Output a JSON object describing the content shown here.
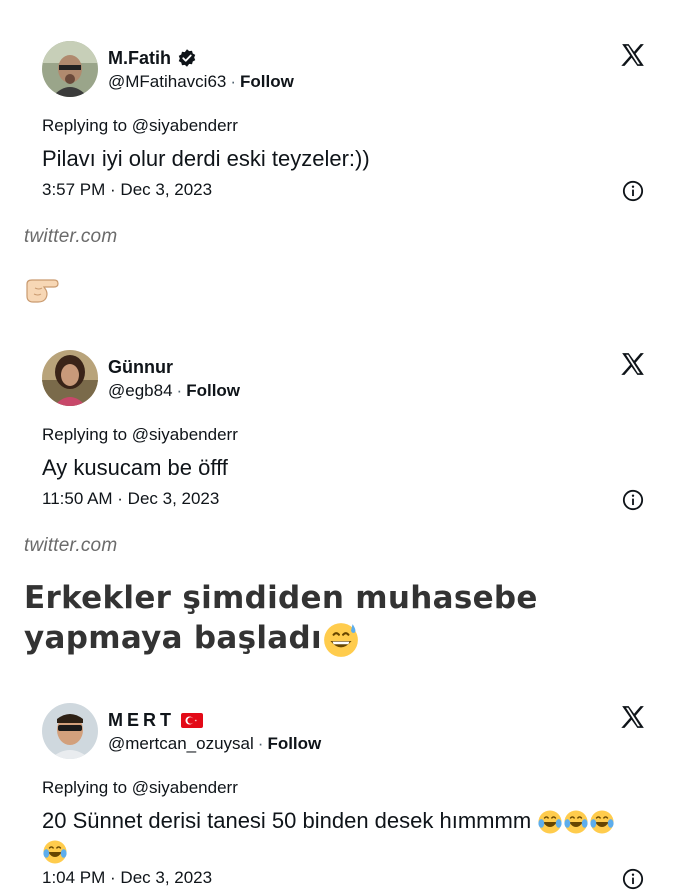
{
  "tweets": [
    {
      "name": "M.Fatih",
      "verified": true,
      "handle": "@MFatihavci63",
      "separator": "·",
      "follow": "Follow",
      "replying": "Replying to @siyabenderr",
      "text": "Pilavı iyi olur derdi eski teyzeler:))",
      "meta": "3:57 PM · Dec 3, 2023"
    },
    {
      "name": "Günnur",
      "verified": false,
      "handle": "@egb84",
      "separator": "·",
      "follow": "Follow",
      "replying": "Replying to @siyabenderr",
      "text": "Ay kusucam be öfff",
      "meta": "11:50 AM · Dec 3, 2023"
    },
    {
      "name": "MERT",
      "flag": "turkey-flag",
      "verified": false,
      "handle": "@mertcan_ozuysal",
      "separator": "·",
      "follow": "Follow",
      "replying": "Replying to @siyabenderr",
      "text": "20 Sünnet derisi tanesi 50 binden desek hımmmm",
      "text_emoji": "face-with-tears-of-joy",
      "meta": "1:04 PM · Dec 3, 2023"
    }
  ],
  "source": "twitter.com",
  "hand_icon": "backhand-index-pointing-right",
  "headline": "Erkekler şimdiden muhasebe yapmaya başladı",
  "headline_emoji": "grinning-face-with-sweat",
  "colors": {
    "text": "#0f1419",
    "source": "#6b6b6b",
    "headline": "#333333"
  }
}
